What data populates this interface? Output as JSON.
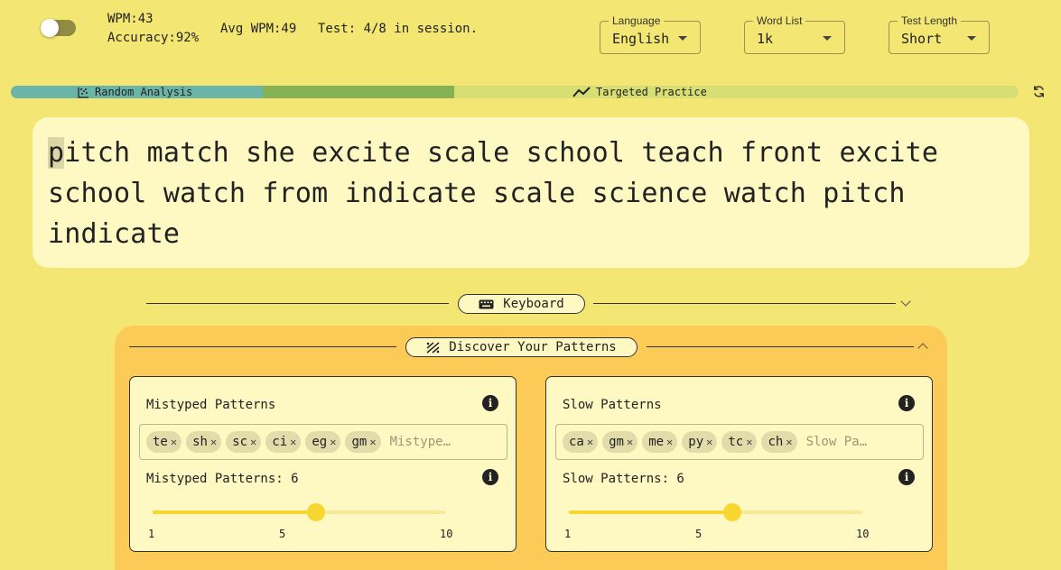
{
  "stats": {
    "wpm": "WPM:43",
    "accuracy": "Accuracy:92%",
    "avg_wpm": "Avg WPM:49",
    "test": "Test: 4/8 in session."
  },
  "settings": {
    "language": {
      "label": "Language",
      "value": "English"
    },
    "word_list": {
      "label": "Word List",
      "value": "1k"
    },
    "test_length": {
      "label": "Test Length",
      "value": "Short"
    }
  },
  "progress": {
    "random_label": "Random Analysis",
    "targeted_label": "Targeted Practice",
    "random_fraction": 0.25,
    "mid_fraction": 0.19
  },
  "typing": {
    "cursor_char": "p",
    "rest": "itch match she excite scale school teach front excite school watch from indicate scale science watch pitch indicate"
  },
  "keyboard_label": "Keyboard",
  "patterns": {
    "title": "Discover Your Patterns",
    "mistyped": {
      "title": "Mistyped Patterns",
      "chips": [
        "te",
        "sh",
        "sc",
        "ci",
        "eg",
        "gm"
      ],
      "placeholder": "Mistype…",
      "slider_label": "Mistyped Patterns: 6",
      "value": 6,
      "min": 1,
      "max": 10,
      "ticks": [
        "1",
        "5",
        "10"
      ]
    },
    "slow": {
      "title": "Slow Patterns",
      "chips": [
        "ca",
        "gm",
        "me",
        "py",
        "tc",
        "ch"
      ],
      "placeholder": "Slow Pa…",
      "slider_label": "Slow Patterns: 6",
      "value": 6,
      "min": 1,
      "max": 10,
      "ticks": [
        "1",
        "5",
        "10"
      ]
    }
  },
  "icons": [
    "toggle-switch",
    "chevron-down-icon",
    "scatter-icon",
    "trend-line-icon",
    "refresh-icon",
    "keyboard-icon",
    "pattern-icon",
    "chevron-down-icon",
    "chevron-up-icon",
    "info-icon",
    "close-icon"
  ],
  "colors": {
    "background": "#f3e672",
    "panel": "#fcca56",
    "card": "#fef8c2",
    "slider": "#f8d630",
    "random_segment": "#6ab4a8",
    "mid_segment": "#86b256",
    "targeted_segment": "#d7de73"
  }
}
